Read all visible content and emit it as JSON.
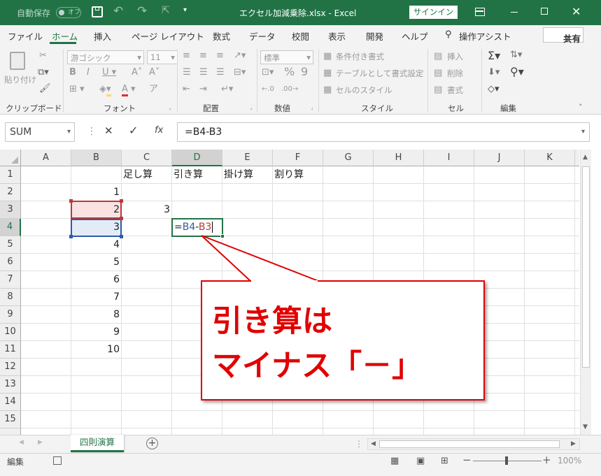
{
  "title": {
    "autosave": "自動保存",
    "autosave_state": "オフ",
    "filename": "エクセル加減乗除.xlsx  -  Excel",
    "signin": "サインイン"
  },
  "tabs": [
    "ファイル",
    "ホーム",
    "挿入",
    "ページ レイアウト",
    "数式",
    "データ",
    "校閲",
    "表示",
    "開発",
    "ヘルプ"
  ],
  "active_tab": "ホーム",
  "tell_me": "操作アシスト",
  "share": "共有",
  "ribbon": {
    "paste": "貼り付け",
    "font_name": "游ゴシック",
    "font_size": "11",
    "number_format": "標準",
    "conditional": "条件付き書式",
    "format_table": "テーブルとして書式設定",
    "cell_style": "セルのスタイル",
    "insert": "挿入",
    "delete": "削除",
    "format": "書式",
    "groups": {
      "clipboard": "クリップボード",
      "font": "フォント",
      "alignment": "配置",
      "number": "数値",
      "styles": "スタイル",
      "cells": "セル",
      "editing": "編集"
    }
  },
  "formula_bar": {
    "name_box": "SUM",
    "formula": "=B4-B3",
    "fx": "fx"
  },
  "columns": [
    "A",
    "B",
    "C",
    "D",
    "E",
    "F",
    "G",
    "H",
    "I",
    "J",
    "K"
  ],
  "rows": [
    "1",
    "2",
    "3",
    "4",
    "5",
    "6",
    "7",
    "8",
    "9",
    "10",
    "11",
    "12",
    "13",
    "14",
    "15"
  ],
  "cells": {
    "C1": "足し算",
    "D1": "引き算",
    "E1": "掛け算",
    "F1": "割り算",
    "B2": "1",
    "B3": "2",
    "B4": "3",
    "B5": "4",
    "B6": "5",
    "B7": "6",
    "B8": "7",
    "B9": "8",
    "B10": "9",
    "B11": "10",
    "C3": "3"
  },
  "edit_cell": {
    "eq": "=",
    "ref1": "B4",
    "minus": "-",
    "ref2": "B3"
  },
  "callout": {
    "line1": "引き算は",
    "line2": "マイナス「－」"
  },
  "sheet_tab": "四則演算",
  "status": {
    "mode": "編集",
    "zoom": "100%"
  },
  "colors": {
    "excel_green": "#217346",
    "callout_red": "#e00000",
    "ref_blue": "#2f5ba8",
    "ref_red": "#b83a3a"
  }
}
